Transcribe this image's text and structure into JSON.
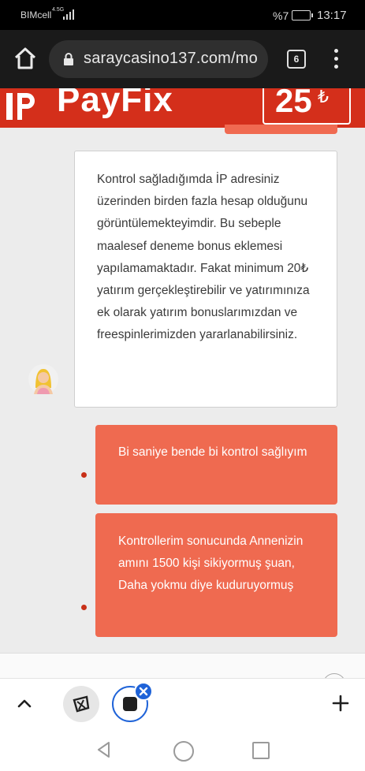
{
  "status_bar": {
    "carrier": "BIMcell",
    "network_small": "4.5G",
    "battery_percent": "%7",
    "time": "13:17"
  },
  "browser": {
    "url": "saraycasino137.com/mo",
    "tab_count": "6",
    "icons": [
      "home-icon",
      "lock-icon",
      "more-vert-icon"
    ]
  },
  "banner": {
    "logo_text": "PayFix",
    "promo_number": "25",
    "promo_symbol": "₺",
    "accent_color": "#d42f1b"
  },
  "chat": {
    "agent_message": "Kontrol sağladığımda İP adresiniz üzerinden birden fazla hesap olduğunu görüntülemekteyimdir. Bu sebeple maalesef deneme bonus eklemesi yapılamamaktadır. Fakat minimum 20₺ yatırım gerçekleştirebilir ve yatırımınıza ek olarak yatırım bonuslarımızdan ve freespinlerimizden yararlanabilirsiniz.",
    "user_messages": [
      "Bi saniye bende bi kontrol sağlıyım",
      "Kontrollerim sonucunda Annenizin amını 1500 kişi sikiyormuş şuan, Daha yokmu diye kuduruyormuş"
    ],
    "user_bubble_color": "#ef6a50",
    "agent_bubble_color": "#ffffff"
  },
  "bottom_toolbar": {
    "icons": [
      "chevron-up-icon",
      "tab-thumbnail",
      "tab-thumbnail-active",
      "close-icon",
      "plus-icon"
    ]
  },
  "nav_bar": {
    "icons": [
      "back-icon",
      "home-circle-icon",
      "recents-icon"
    ]
  }
}
